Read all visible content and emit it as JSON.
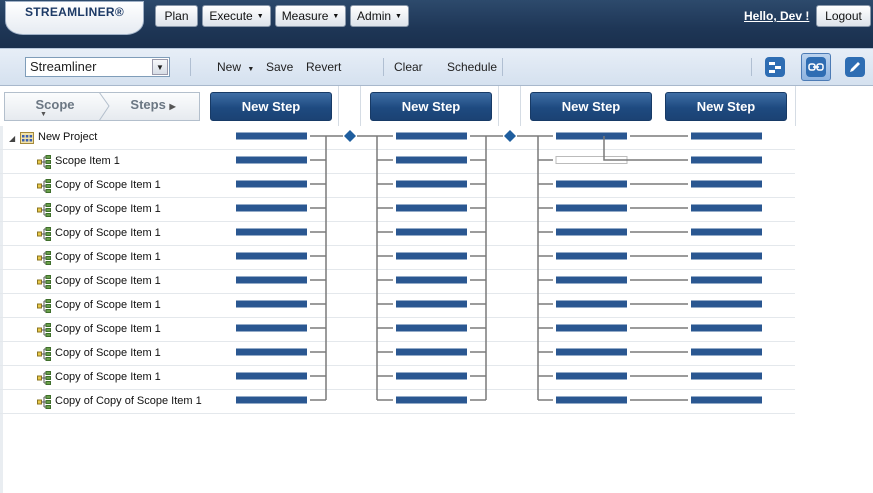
{
  "app": {
    "logo": "STREAMLINER®",
    "nav": [
      {
        "label": "Plan",
        "has_menu": false
      },
      {
        "label": "Execute",
        "has_menu": true
      },
      {
        "label": "Measure",
        "has_menu": true
      },
      {
        "label": "Admin",
        "has_menu": true
      }
    ],
    "greeting": "Hello, Dev !",
    "logout": "Logout"
  },
  "toolbar": {
    "project": "Streamliner",
    "new": "New",
    "save": "Save",
    "revert": "Revert",
    "clear": "Clear",
    "schedule": "Schedule",
    "icons": [
      "flow-view-icon",
      "link-icon",
      "edit-pencil-icon"
    ],
    "active_icon": "link-icon"
  },
  "header": {
    "scope": "Scope",
    "steps": "Steps",
    "new_step_buttons": [
      "New Step",
      "New Step",
      "New Step",
      "New Step"
    ]
  },
  "tree": {
    "root": "New Project",
    "items": [
      "Scope Item 1",
      "Copy of Scope Item 1",
      "Copy of Scope Item 1",
      "Copy of Scope Item 1",
      "Copy of Scope Item 1",
      "Copy of Scope Item 1",
      "Copy of Scope Item 1",
      "Copy of Scope Item 1",
      "Copy of Scope Item 1",
      "Copy of Scope Item 1",
      "Copy of Copy of Scope Item 1"
    ]
  },
  "colors": {
    "topbar": "#1e3656",
    "step_bar": "#2a5791",
    "connector": "#7a7a7a",
    "milestone": "#1f5e9e"
  }
}
